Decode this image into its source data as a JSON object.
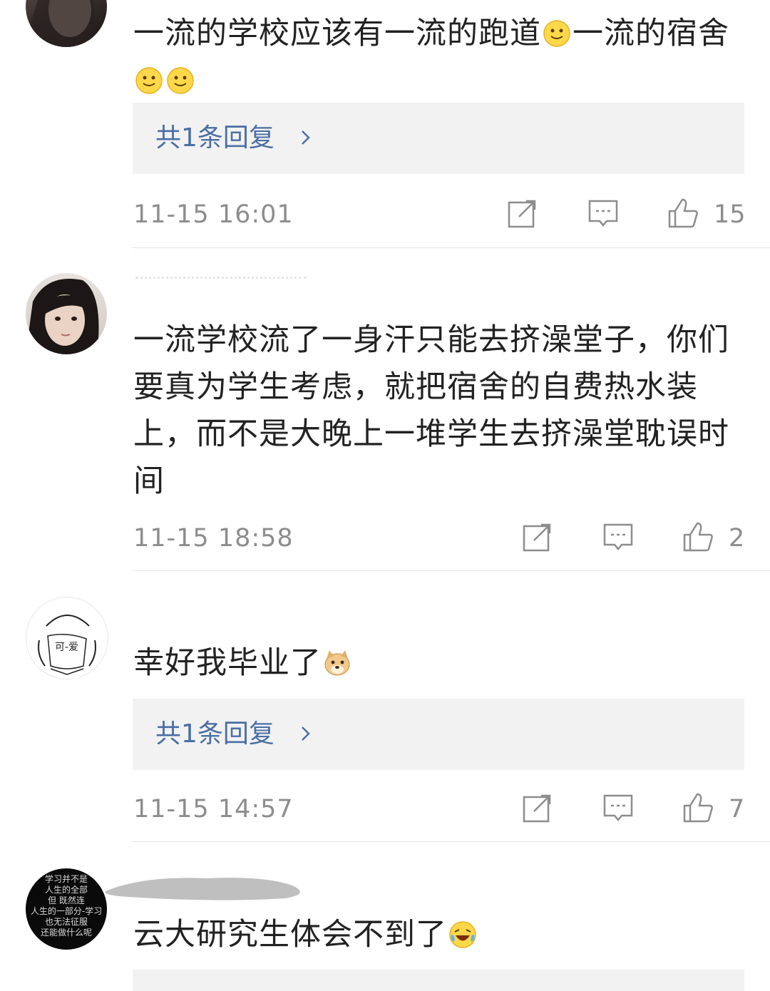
{
  "comments": [
    {
      "text_parts": [
        "一流的学校应该有一流的跑道",
        "一流的宿舍"
      ],
      "emoji": "smile",
      "replies_label": "共1条回复",
      "time": "11-15 16:01",
      "likes": "15"
    },
    {
      "text_lines": [
        "一流学校流了一身汗只能去挤澡堂子，你们",
        "要真为学生考虑，就把宿舍的自费热水装",
        "上，而不是大晚上一堆学生去挤澡堂耽误时",
        "间"
      ],
      "time": "11-15 18:58",
      "likes": "2"
    },
    {
      "text": "幸好我毕业了",
      "emoji": "doge",
      "replies_label": "共1条回复",
      "time": "11-15 14:57",
      "likes": "7"
    },
    {
      "text": "云大研究生体会不到了",
      "emoji": "laugh-cry",
      "avatar_text": [
        "学习并不是",
        "人生的全部",
        "但 既然连",
        "人生的一部分-学习",
        "也无法征服",
        "还能做什么呢"
      ]
    }
  ],
  "icons": {
    "share": "share-icon",
    "comment": "comment-icon",
    "like": "like-icon",
    "chevron": "chevron-right-icon"
  },
  "colors": {
    "text": "#222222",
    "link": "#4a6fa5",
    "meta": "#8d8d8d",
    "reply_bg": "#f2f2f2",
    "divider": "#e4e4e4"
  }
}
